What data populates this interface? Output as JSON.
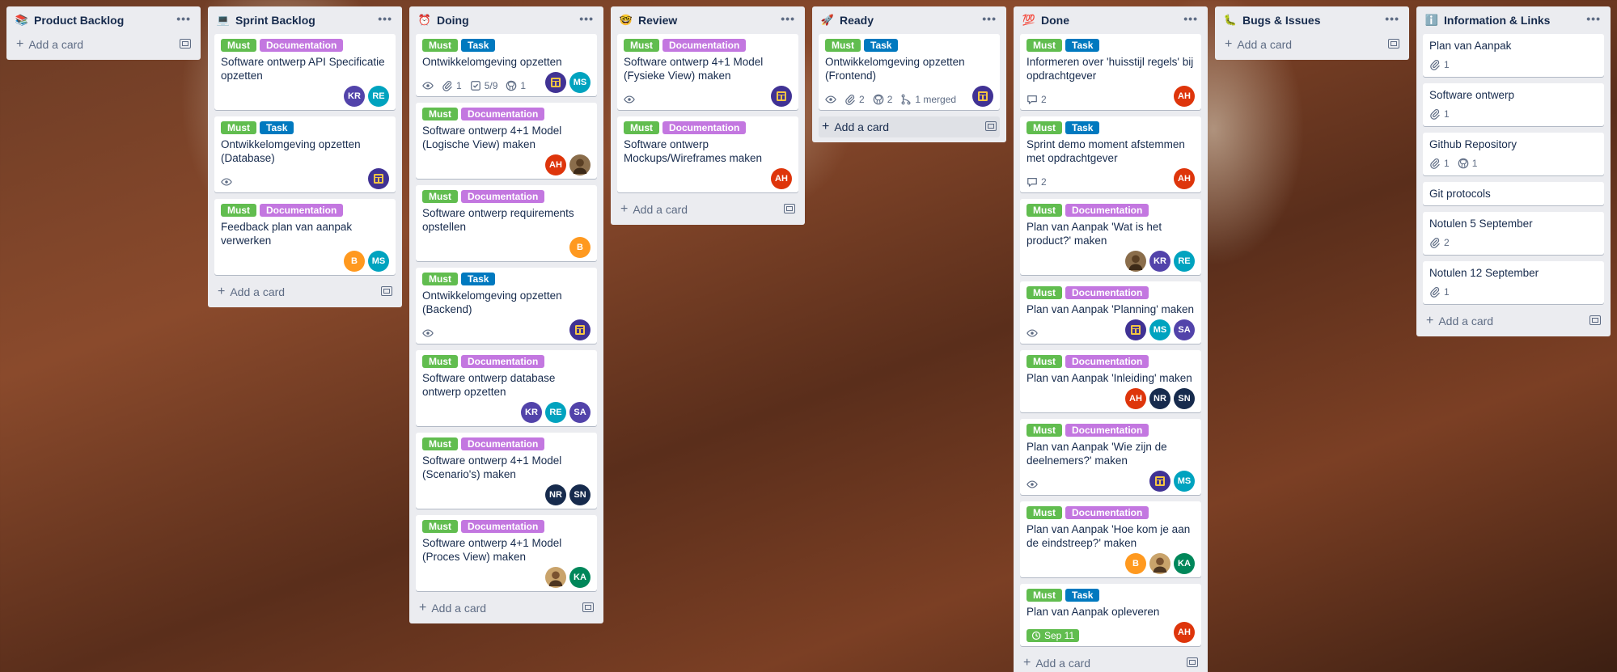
{
  "lists": [
    {
      "title": "Product Backlog",
      "emoji": "📚",
      "add_label": "Add a card",
      "cards": []
    },
    {
      "title": "Sprint Backlog",
      "emoji": "💻",
      "add_label": "Add a card",
      "cards": [
        {
          "labels": [
            "Must",
            "Documentation"
          ],
          "title": "Software ontwerp API Specificatie opzetten",
          "members": [
            "KR",
            "RE"
          ]
        },
        {
          "labels": [
            "Must",
            "Task"
          ],
          "title": "Ontwikkelomgeving opzetten (Database)",
          "watch": true,
          "members": [
            "LOGO"
          ]
        },
        {
          "labels": [
            "Must",
            "Documentation"
          ],
          "title": "Feedback plan van aanpak verwerken",
          "members": [
            "B",
            "MS"
          ]
        }
      ]
    },
    {
      "title": "Doing",
      "emoji": "⏰",
      "add_label": "Add a card",
      "cards": [
        {
          "labels": [
            "Must",
            "Task"
          ],
          "title": "Ontwikkelomgeving opzetten",
          "watch": true,
          "attachments": "1",
          "checklist": "5/9",
          "github": "1",
          "members": [
            "LOGO",
            "MS"
          ]
        },
        {
          "labels": [
            "Must",
            "Documentation"
          ],
          "title": "Software ontwerp 4+1 Model (Logische View) maken",
          "members": [
            "AH",
            "IMG1"
          ]
        },
        {
          "labels": [
            "Must",
            "Documentation"
          ],
          "title": "Software ontwerp requirements opstellen",
          "members": [
            "B"
          ]
        },
        {
          "labels": [
            "Must",
            "Task"
          ],
          "title": "Ontwikkelomgeving opzetten (Backend)",
          "watch": true,
          "members": [
            "LOGO"
          ]
        },
        {
          "labels": [
            "Must",
            "Documentation"
          ],
          "title": "Software ontwerp database ontwerp opzetten",
          "members": [
            "KR",
            "RE",
            "SA"
          ]
        },
        {
          "labels": [
            "Must",
            "Documentation"
          ],
          "title": "Software ontwerp 4+1 Model (Scenario's) maken",
          "members": [
            "NR",
            "SN"
          ]
        },
        {
          "labels": [
            "Must",
            "Documentation"
          ],
          "title": "Software ontwerp 4+1 Model (Proces View) maken",
          "members": [
            "IMG2",
            "KA"
          ]
        }
      ]
    },
    {
      "title": "Review",
      "emoji": "🤓",
      "add_label": "Add a card",
      "cards": [
        {
          "labels": [
            "Must",
            "Documentation"
          ],
          "title": "Software ontwerp 4+1 Model (Fysieke View) maken",
          "watch": true,
          "members": [
            "LOGO"
          ]
        },
        {
          "labels": [
            "Must",
            "Documentation"
          ],
          "title": "Software ontwerp Mockups/Wireframes maken",
          "members": [
            "AH"
          ]
        }
      ]
    },
    {
      "title": "Ready",
      "emoji": "🚀",
      "add_label": "Add a card",
      "cards": [
        {
          "labels": [
            "Must",
            "Task"
          ],
          "title": "Ontwikkelomgeving opzetten (Frontend)",
          "watch": true,
          "attachments": "2",
          "github": "2",
          "merged": "1 merged",
          "members": [
            "LOGO"
          ]
        }
      ]
    },
    {
      "title": "Done",
      "emoji": "💯",
      "add_label": "Add a card",
      "cards": [
        {
          "labels": [
            "Must",
            "Task"
          ],
          "title": "Informeren over 'huisstijl regels' bij opdrachtgever",
          "comments": "2",
          "members": [
            "AH"
          ]
        },
        {
          "labels": [
            "Must",
            "Task"
          ],
          "title": "Sprint demo moment afstemmen met opdrachtgever",
          "comments": "2",
          "members": [
            "AH"
          ]
        },
        {
          "labels": [
            "Must",
            "Documentation"
          ],
          "title": "Plan van Aanpak 'Wat is het product?' maken",
          "members": [
            "IMG1",
            "KR",
            "RE"
          ]
        },
        {
          "labels": [
            "Must",
            "Documentation"
          ],
          "title": "Plan van Aanpak 'Planning' maken",
          "watch": true,
          "members": [
            "LOGO",
            "MS",
            "SA"
          ]
        },
        {
          "labels": [
            "Must",
            "Documentation"
          ],
          "title": "Plan van Aanpak 'Inleiding' maken",
          "members": [
            "AH",
            "NR",
            "SN"
          ]
        },
        {
          "labels": [
            "Must",
            "Documentation"
          ],
          "title": "Plan van Aanpak 'Wie zijn de deelnemers?' maken",
          "watch": true,
          "members": [
            "LOGO",
            "MS"
          ]
        },
        {
          "labels": [
            "Must",
            "Documentation"
          ],
          "title": "Plan van Aanpak 'Hoe kom je aan de eindstreep?' maken",
          "members": [
            "B",
            "IMG2",
            "KA"
          ]
        },
        {
          "labels": [
            "Must",
            "Task"
          ],
          "title": "Plan van Aanpak opleveren",
          "due": "Sep 11",
          "members": [
            "AH"
          ]
        }
      ]
    },
    {
      "title": "Bugs & Issues",
      "emoji": "🐛",
      "add_label": "Add a card",
      "cards": []
    },
    {
      "title": "Information & Links",
      "emoji": "ℹ️",
      "add_label": "Add a card",
      "cards": [
        {
          "title": "Plan van Aanpak",
          "attachments": "1"
        },
        {
          "title": "Software ontwerp",
          "attachments": "1"
        },
        {
          "title": "Github Repository",
          "attachments": "1",
          "github": "1"
        },
        {
          "title": "Git protocols"
        },
        {
          "title": "Notulen 5 September",
          "attachments": "2"
        },
        {
          "title": "Notulen 12 September",
          "attachments": "1"
        }
      ]
    }
  ],
  "avatar_colors": {
    "KR": "#5243aa",
    "RE": "#00a3bf",
    "MS": "#00a3bf",
    "B": "#ff991f",
    "AH": "#de350b",
    "SA": "#5243aa",
    "NR": "#172b4d",
    "SN": "#172b4d",
    "KA": "#00875a",
    "LOGO": "#403294",
    "IMG1": "#8a6d4b",
    "IMG2": "#c9a36b"
  },
  "colors": {
    "must": "#61bd4f",
    "documentation": "#c377e0",
    "task": "#0079bf",
    "list_bg": "#ebecf0"
  }
}
